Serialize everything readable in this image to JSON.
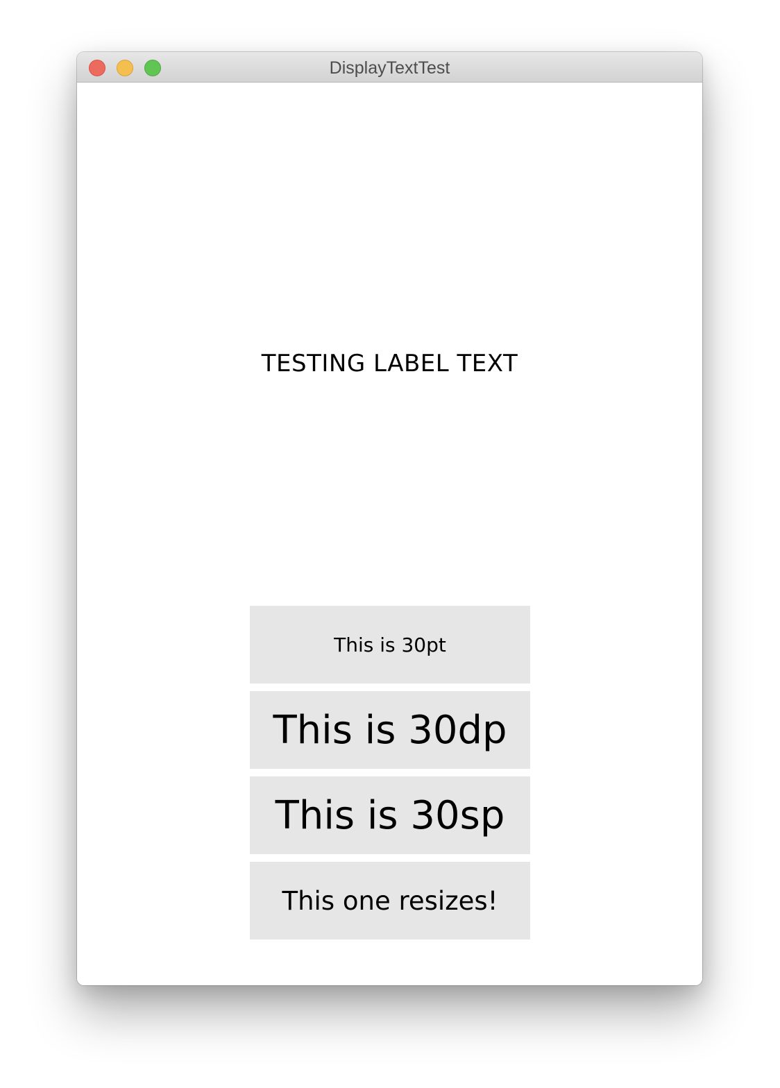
{
  "window": {
    "title": "DisplayTextTest",
    "controls": {
      "close_color": "#ed6a5e",
      "minimize_color": "#f5bf4f",
      "zoom_color": "#61c554"
    }
  },
  "content": {
    "label_text": "TESTING LABEL TEXT",
    "buttons": [
      {
        "label": "This is 30pt"
      },
      {
        "label": "This is 30dp"
      },
      {
        "label": "This is 30sp"
      },
      {
        "label": "This one resizes!"
      }
    ],
    "button_bg": "#e6e6e6"
  }
}
